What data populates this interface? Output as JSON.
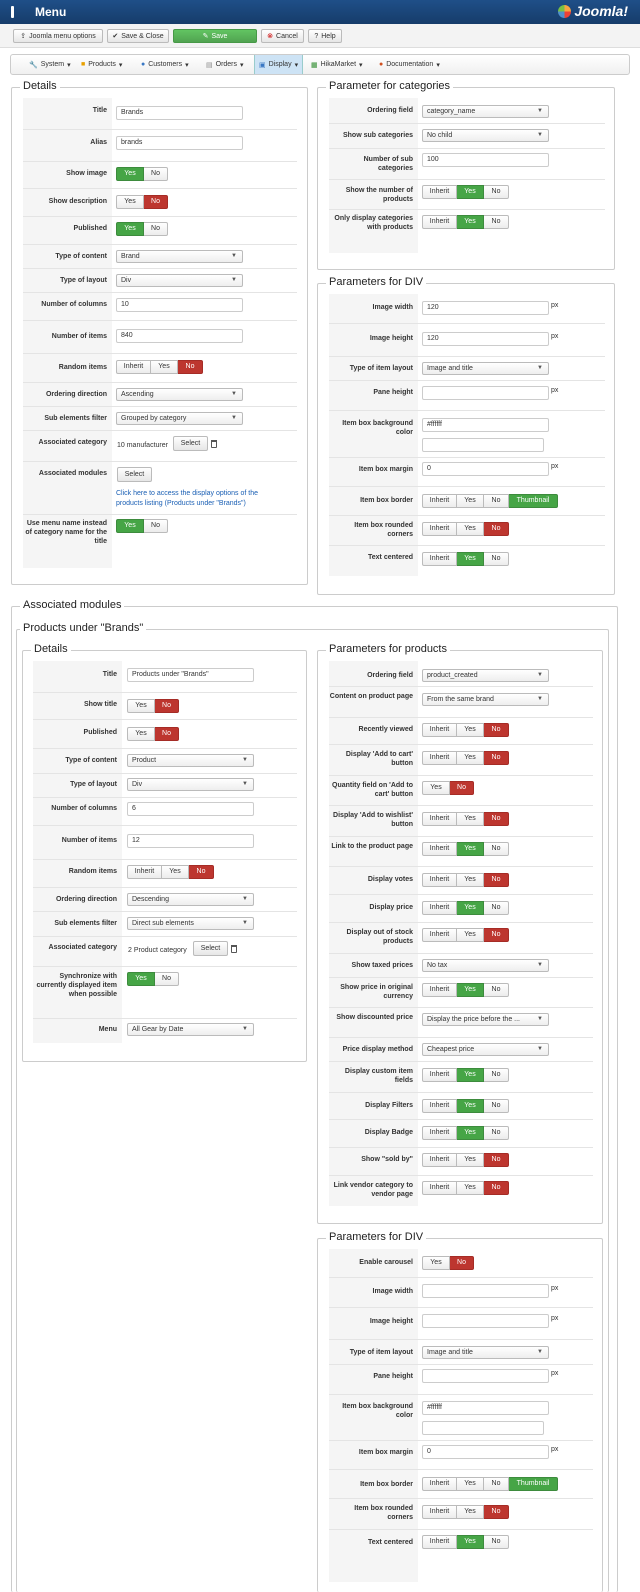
{
  "header": {
    "title": "Menu",
    "logo_text": "Joomla!"
  },
  "toolbar": {
    "options": "Joomla menu options",
    "save_close": "Save & Close",
    "save": "Save",
    "cancel": "Cancel",
    "help": "Help"
  },
  "menu": {
    "system": "System",
    "products": "Products",
    "customers": "Customers",
    "orders": "Orders",
    "display": "Display",
    "hikamarket": "HikaMarket",
    "documentation": "Documentation"
  },
  "common": {
    "yes": "Yes",
    "no": "No",
    "inherit": "Inherit",
    "thumbnail": "Thumbnail",
    "select": "Select",
    "px": "px"
  },
  "details": {
    "legend": "Details",
    "title_label": "Title",
    "title_value": "Brands",
    "alias_label": "Alias",
    "alias_value": "brands",
    "show_image": "Show image",
    "show_description": "Show description",
    "published": "Published",
    "type_content_label": "Type of content",
    "type_content_value": "Brand",
    "type_layout_label": "Type of layout",
    "type_layout_value": "Div",
    "columns_label": "Number of columns",
    "columns_value": "10",
    "items_label": "Number of items",
    "items_value": "840",
    "random_label": "Random items",
    "ordering_dir_label": "Ordering direction",
    "ordering_dir_value": "Ascending",
    "sub_filter_label": "Sub elements filter",
    "sub_filter_value": "Grouped by category",
    "assoc_cat_label": "Associated category",
    "assoc_cat_value": "10 manufacturer",
    "assoc_mod_label": "Associated modules",
    "assoc_mod_link": "Click here to access the display options of the products listing (Products under \"Brands\")",
    "use_menu_name_label": "Use menu name instead of category name for the title"
  },
  "categories": {
    "legend": "Parameter for categories",
    "ordering_label": "Ordering field",
    "ordering_value": "category_name",
    "sub_label": "Show sub categories",
    "sub_value": "No child",
    "num_sub_label": "Number of sub categories",
    "num_sub_value": "100",
    "num_products_label": "Show the number of products",
    "only_display_label": "Only display categories with products"
  },
  "div1": {
    "legend": "Parameters for DIV",
    "width_label": "Image width",
    "width_value": "120",
    "height_label": "Image height",
    "height_value": "120",
    "layout_label": "Type of item layout",
    "layout_value": "Image and title",
    "pane_label": "Pane height",
    "bg_label": "Item box background color",
    "bg_value": "#ffffff",
    "margin_label": "Item box margin",
    "margin_value": "0",
    "border_label": "Item box border",
    "rounded_label": "Item box rounded corners",
    "centered_label": "Text centered"
  },
  "assoc": {
    "legend": "Associated modules",
    "sub_legend": "Products under \"Brands\""
  },
  "pdetails": {
    "legend": "Details",
    "title_label": "Title",
    "title_value": "Products under \"Brands\"",
    "show_title": "Show title",
    "published": "Published",
    "type_content_label": "Type of content",
    "type_content_value": "Product",
    "type_layout_label": "Type of layout",
    "type_layout_value": "Div",
    "columns_label": "Number of columns",
    "columns_value": "6",
    "items_label": "Number of items",
    "items_value": "12",
    "random_label": "Random items",
    "ordering_dir_label": "Ordering direction",
    "ordering_dir_value": "Descending",
    "sub_filter_label": "Sub elements filter",
    "sub_filter_value": "Direct sub elements",
    "assoc_cat_label": "Associated category",
    "assoc_cat_value": "2 Product category",
    "sync_label": "Synchronize with currently displayed item when possible",
    "menu_label": "Menu",
    "menu_value": "All Gear by Date"
  },
  "pparams": {
    "legend": "Parameters for products",
    "ordering_label": "Ordering field",
    "ordering_value": "product_created",
    "content_label": "Content on product page",
    "content_value": "From the same brand",
    "recent_label": "Recently viewed",
    "add_cart_label": "Display 'Add to cart' button",
    "qty_label": "Quantity field on 'Add to cart' button",
    "wishlist_label": "Display 'Add to wishlist' button",
    "link_label": "Link to the product page",
    "votes_label": "Display votes",
    "price_label": "Display price",
    "oos_label": "Display out of stock products",
    "taxed_label": "Show taxed prices",
    "taxed_value": "No tax",
    "orig_label": "Show price in original currency",
    "discount_label": "Show discounted price",
    "discount_value": "Display the price before the ...",
    "method_label": "Price display method",
    "method_value": "Cheapest price",
    "custom_label": "Display custom item fields",
    "filters_label": "Display Filters",
    "badge_label": "Display Badge",
    "sold_label": "Show \"sold by\"",
    "vendor_label": "Link vendor category to vendor page"
  },
  "div2": {
    "legend": "Parameters for DIV",
    "carousel_label": "Enable carousel",
    "width_label": "Image width",
    "height_label": "Image height",
    "layout_label": "Type of item layout",
    "layout_value": "Image and title",
    "pane_label": "Pane height",
    "bg_label": "Item box background color",
    "bg_value": "#ffffff",
    "margin_label": "Item box margin",
    "margin_value": "0",
    "border_label": "Item box border",
    "rounded_label": "Item box rounded corners",
    "centered_label": "Text centered"
  }
}
